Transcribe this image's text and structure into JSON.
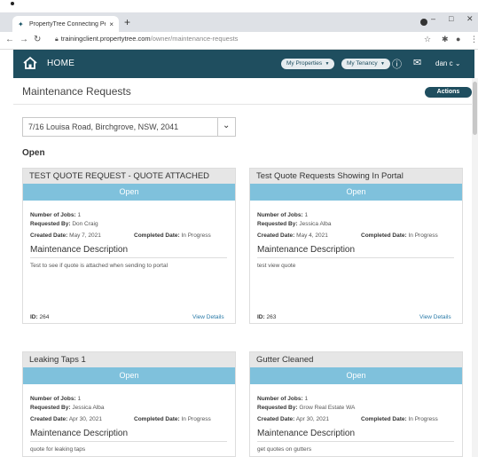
{
  "browser": {
    "tab_title": "PropertyTree Connecting People",
    "tab_close": "×",
    "new_tab": "+",
    "url_host": "trainingclient.propertytree.com",
    "url_path": "/owner/maintenance-requests"
  },
  "header": {
    "home_label": "HOME",
    "my_properties": "My Properties",
    "my_tenancy": "My Tenancy",
    "user_name": "dan c"
  },
  "page": {
    "title": "Maintenance Requests",
    "actions_label": "Actions"
  },
  "property_select": {
    "value": "7/16 Louisa Road, Birchgrove, NSW, 2041"
  },
  "section": {
    "label": "Open"
  },
  "labels": {
    "jobs": "Number of Jobs:",
    "requested_by": "Requested By:",
    "created": "Created Date:",
    "completed": "Completed Date:",
    "md_title": "Maintenance Description",
    "id": "ID:",
    "view_details": "View Details"
  },
  "cards": [
    {
      "title": "TEST QUOTE REQUEST - QUOTE ATTACHED",
      "status": "Open",
      "jobs": "1",
      "requested_by": "Don Craig",
      "created": "May 7, 2021",
      "completed": "In Progress",
      "description": "Test to see if quote is attached when sending to portal",
      "id": "264"
    },
    {
      "title": "Test Quote Requests Showing In Portal",
      "status": "Open",
      "jobs": "1",
      "requested_by": "Jessica Alba",
      "created": "May 4, 2021",
      "completed": "In Progress",
      "description": "test view quote",
      "id": "263"
    },
    {
      "title": "Leaking Taps 1",
      "status": "Open",
      "jobs": "1",
      "requested_by": "Jessica Alba",
      "created": "Apr 30, 2021",
      "completed": "In Progress",
      "description": "quote for leaking taps",
      "id": ""
    },
    {
      "title": "Gutter Cleaned",
      "status": "Open",
      "jobs": "1",
      "requested_by": "Grow Real Estate WA",
      "created": "Apr 30, 2021",
      "completed": "In Progress",
      "description": "get quotes on gutters",
      "id": ""
    }
  ],
  "colors": {
    "header_bg": "#1f4e5f",
    "status_bar": "#7fc1dc",
    "link": "#2a7aa8"
  }
}
